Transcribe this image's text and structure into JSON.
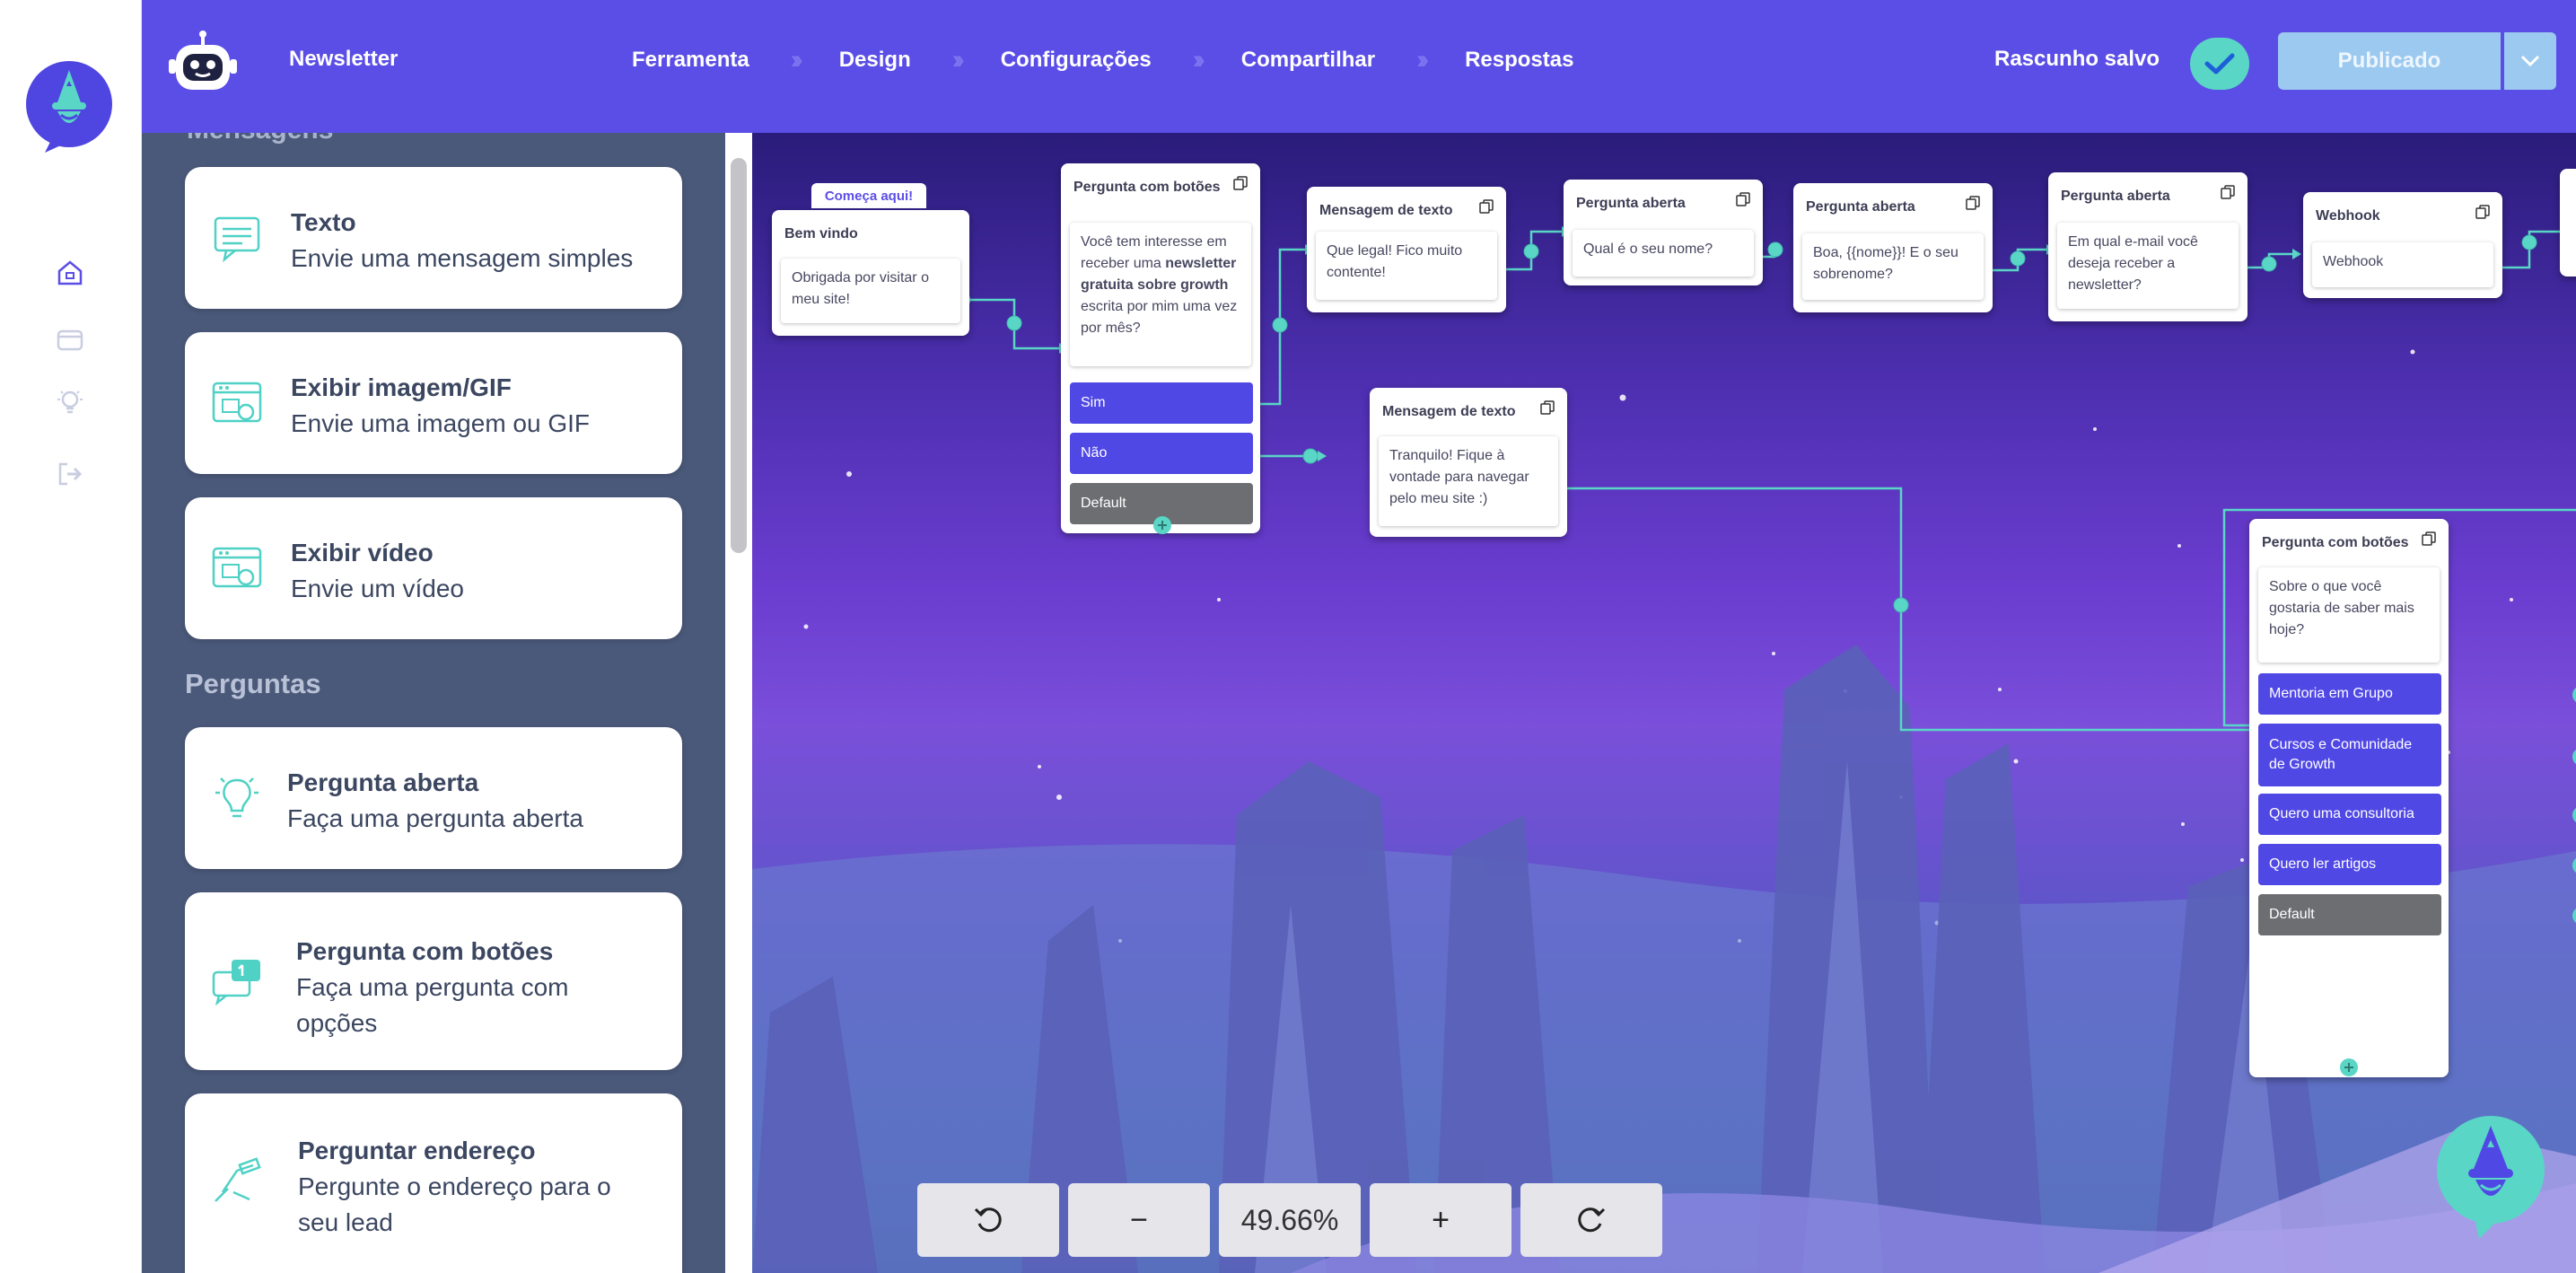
{
  "header": {
    "project_name": "Newsletter",
    "steps": [
      "Ferramenta",
      "Design",
      "Configurações",
      "Compartilhar",
      "Respostas"
    ],
    "status_text": "Rascunho salvo",
    "publish_label": "Publicado"
  },
  "sidebar": {
    "clipped_section": "Mensagens",
    "cards_top": [
      {
        "title": "Texto",
        "desc": "Envie uma mensagem simples",
        "icon": "message-icon"
      },
      {
        "title": "Exibir imagem/GIF",
        "desc": "Envie uma imagem ou GIF",
        "icon": "image-icon"
      },
      {
        "title": "Exibir vídeo",
        "desc": "Envie um vídeo",
        "icon": "video-icon"
      }
    ],
    "section_questions": "Perguntas",
    "cards_questions": [
      {
        "title": "Pergunta aberta",
        "desc": "Faça uma pergunta aberta",
        "icon": "lightbulb-icon"
      },
      {
        "title": "Pergunta com botões",
        "desc_line1": "Faça uma pergunta com",
        "desc_line2": "opções",
        "icon": "chat-buttons-icon"
      },
      {
        "title": "Perguntar endereço",
        "desc_line1": "Pergunte o endereço para o",
        "desc_line2": "seu lead",
        "icon": "address-icon"
      }
    ]
  },
  "flow": {
    "start_tag": "Começa aqui!",
    "nodes": {
      "welcome": {
        "title": "Bem vindo",
        "text": "Obrigada por visitar o meu site!"
      },
      "q_buttons1": {
        "title": "Pergunta com botões",
        "text_pre": "Você tem interesse em receber uma ",
        "text_bold": "newsletter gratuita sobre growth",
        "text_post": " escrita por mim uma vez por mês?",
        "buttons": [
          "Sim",
          "Não",
          "Default"
        ]
      },
      "msg1": {
        "title": "Mensagem de texto",
        "text": "Que legal! Fico muito contente!"
      },
      "msg2": {
        "title": "Mensagem de texto",
        "text": "Tranquilo! Fique à vontade para navegar pelo meu site :)"
      },
      "open1": {
        "title": "Pergunta aberta",
        "text": "Qual é o seu nome?"
      },
      "open2": {
        "title": "Pergunta aberta",
        "text": "Boa, {{nome}}! E o seu sobrenome?"
      },
      "open3": {
        "title": "Pergunta aberta",
        "text": "Em qual e-mail você deseja receber a newsletter?"
      },
      "webhook": {
        "title": "Webhook",
        "text": "Webhook"
      },
      "q_buttons2": {
        "title": "Pergunta com botões",
        "text": "Sobre o que você gostaria de saber mais hoje?",
        "buttons": [
          "Mentoria em Grupo",
          "Cursos e Comunidade de Growth",
          "Quero uma consultoria",
          "Quero ler artigos",
          "Default"
        ]
      }
    }
  },
  "zoom": {
    "level": "49.66%",
    "undo_icon": "undo-icon",
    "minus": "−",
    "plus": "+",
    "redo_icon": "redo-icon"
  },
  "colors": {
    "header": "#5b4ee6",
    "accent": "#59d6c6",
    "sidebar": "#4a5879",
    "button": "#5048e5"
  }
}
